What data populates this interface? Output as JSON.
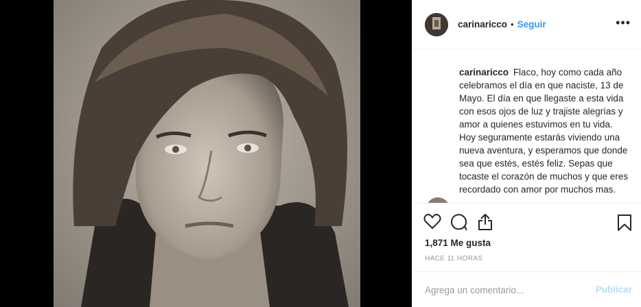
{
  "header": {
    "username": "carinaricco",
    "separator": "•",
    "follow_label": "Seguir",
    "more_label": "•••"
  },
  "caption": {
    "username": "carinaricco",
    "text": "Flaco, hoy como cada año celebramos el día en que naciste, 13 de Mayo. El día en que llegaste a esta vida con esos ojos de luz y trajiste alegrías y amor a quienes estuvimos en tu vida. Hoy seguramente estarás viviendo una nueva aventura, y esperamos que donde sea que estés, estés feliz. Sepas que tocaste el corazón de muchos y que eres recordado con amor por muchos mas."
  },
  "actions": {
    "likes": "1,871 Me gusta",
    "time": "HACE 11 HORAS",
    "icons": [
      "heart-icon",
      "comment-icon",
      "share-icon",
      "bookmark-icon"
    ]
  },
  "comment_box": {
    "placeholder": "Agrega un comentario...",
    "post_label": "Publicar"
  },
  "colors": {
    "link": "#3897f0",
    "post_disabled": "#b2dffc",
    "muted": "#999999",
    "border": "#efefef"
  }
}
